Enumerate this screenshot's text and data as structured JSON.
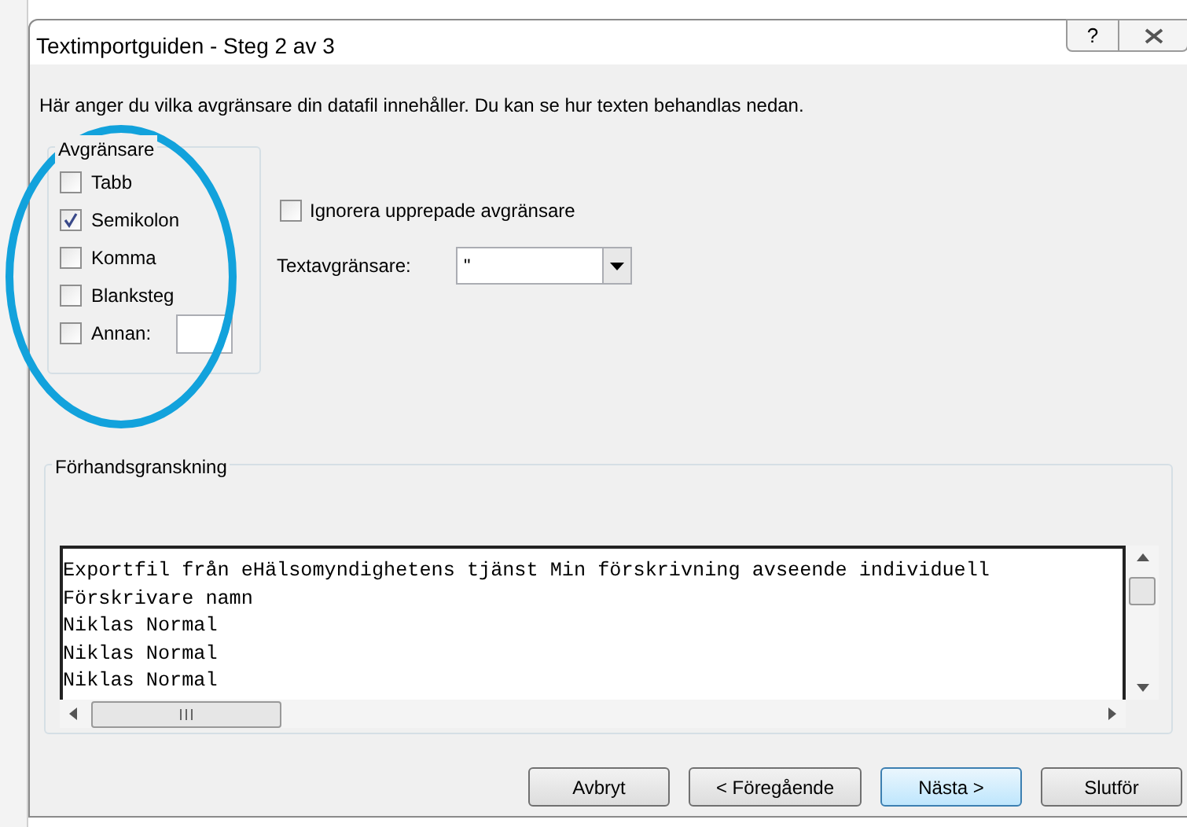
{
  "window": {
    "title": "Textimportguiden - Steg 2 av 3",
    "help_button": "?"
  },
  "instruction": "Här anger du vilka avgränsare din datafil innehåller. Du kan se hur texten behandlas nedan.",
  "delimiters": {
    "title": "Avgränsare",
    "items": [
      {
        "label": "Tabb",
        "checked": false
      },
      {
        "label": "Semikolon",
        "checked": true
      },
      {
        "label": "Komma",
        "checked": false
      },
      {
        "label": "Blanksteg",
        "checked": false
      },
      {
        "label": "Annan:",
        "checked": false,
        "kind": "with-field"
      }
    ]
  },
  "ignore_repeated": {
    "label": "Ignorera upprepade avgränsare",
    "checked": false
  },
  "text_qualifier": {
    "label": "Textavgränsare:",
    "value": "\""
  },
  "preview": {
    "title": "Förhandsgranskning",
    "lines": [
      "Exportfil från eHälsomyndighetens tjänst Min förskrivning avseende individuell",
      "Förskrivare namn",
      "Niklas Normal",
      "Niklas Normal",
      "Niklas Normal"
    ]
  },
  "buttons": [
    {
      "label": "Avbryt",
      "selected": false
    },
    {
      "label": "< Föregående",
      "selected": false
    },
    {
      "label": "Nästa >",
      "selected": true
    },
    {
      "label": "Slutför",
      "selected": false
    }
  ]
}
